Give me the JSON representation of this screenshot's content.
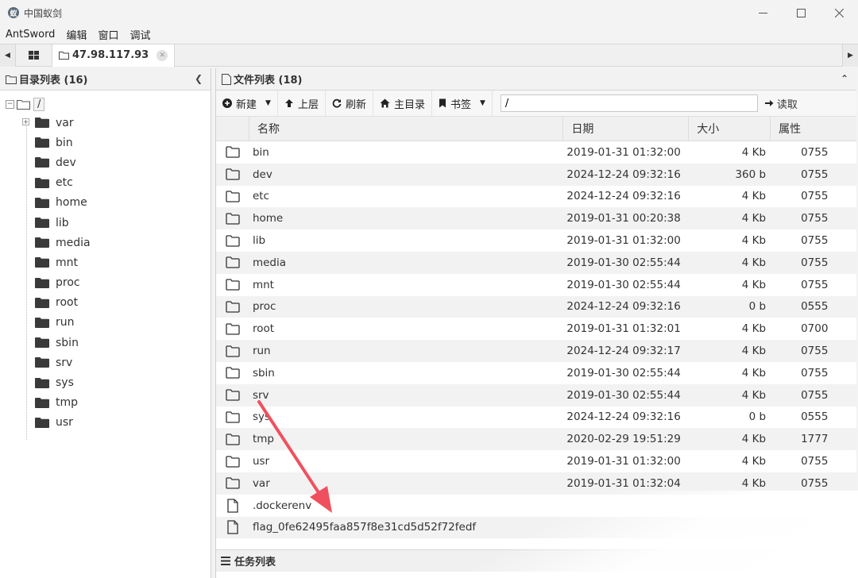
{
  "window": {
    "title": "中国蚁剑",
    "logo_glyph": "蚁"
  },
  "menu": [
    "AntSword",
    "编辑",
    "窗口",
    "调试"
  ],
  "tabs": {
    "active_label": "47.98.117.93"
  },
  "left_panel": {
    "header": "目录列表 (16)",
    "root": "/",
    "items": [
      "var",
      "bin",
      "dev",
      "etc",
      "home",
      "lib",
      "media",
      "mnt",
      "proc",
      "root",
      "run",
      "sbin",
      "srv",
      "sys",
      "tmp",
      "usr"
    ]
  },
  "right_panel": {
    "header": "文件列表 (18)",
    "toolbar": {
      "new": "新建",
      "up": "上层",
      "refresh": "刷新",
      "home": "主目录",
      "bookmark": "书签",
      "path_value": "/",
      "go": "读取"
    },
    "columns": {
      "name": "名称",
      "date": "日期",
      "size": "大小",
      "attr": "属性"
    },
    "rows": [
      {
        "type": "folder",
        "name": "bin",
        "date": "2019-01-31 01:32:00",
        "size": "4 Kb",
        "attr": "0755"
      },
      {
        "type": "folder",
        "name": "dev",
        "date": "2024-12-24 09:32:16",
        "size": "360 b",
        "attr": "0755"
      },
      {
        "type": "folder",
        "name": "etc",
        "date": "2024-12-24 09:32:16",
        "size": "4 Kb",
        "attr": "0755"
      },
      {
        "type": "folder",
        "name": "home",
        "date": "2019-01-31 00:20:38",
        "size": "4 Kb",
        "attr": "0755"
      },
      {
        "type": "folder",
        "name": "lib",
        "date": "2019-01-31 01:32:00",
        "size": "4 Kb",
        "attr": "0755"
      },
      {
        "type": "folder",
        "name": "media",
        "date": "2019-01-30 02:55:44",
        "size": "4 Kb",
        "attr": "0755"
      },
      {
        "type": "folder",
        "name": "mnt",
        "date": "2019-01-30 02:55:44",
        "size": "4 Kb",
        "attr": "0755"
      },
      {
        "type": "folder",
        "name": "proc",
        "date": "2024-12-24 09:32:16",
        "size": "0 b",
        "attr": "0555"
      },
      {
        "type": "folder",
        "name": "root",
        "date": "2019-01-31 01:32:01",
        "size": "4 Kb",
        "attr": "0700"
      },
      {
        "type": "folder",
        "name": "run",
        "date": "2024-12-24 09:32:17",
        "size": "4 Kb",
        "attr": "0755"
      },
      {
        "type": "folder",
        "name": "sbin",
        "date": "2019-01-30 02:55:44",
        "size": "4 Kb",
        "attr": "0755"
      },
      {
        "type": "folder",
        "name": "srv",
        "date": "2019-01-30 02:55:44",
        "size": "4 Kb",
        "attr": "0755"
      },
      {
        "type": "folder",
        "name": "sys",
        "date": "2024-12-24 09:32:16",
        "size": "0 b",
        "attr": "0555"
      },
      {
        "type": "folder",
        "name": "tmp",
        "date": "2020-02-29 19:51:29",
        "size": "4 Kb",
        "attr": "1777"
      },
      {
        "type": "folder",
        "name": "usr",
        "date": "2019-01-31 01:32:00",
        "size": "4 Kb",
        "attr": "0755"
      },
      {
        "type": "folder",
        "name": "var",
        "date": "2019-01-31 01:32:04",
        "size": "4 Kb",
        "attr": "0755"
      },
      {
        "type": "file",
        "name": ".dockerenv",
        "date": "",
        "size": "",
        "attr": ""
      },
      {
        "type": "file",
        "name": "flag_0fe62495faa857f8e31cd5d52f72fedf",
        "date": "",
        "size": "",
        "attr": ""
      }
    ]
  },
  "task_bar": {
    "label": "任务列表"
  },
  "colors": {
    "annotation_arrow": "#f0505e"
  }
}
